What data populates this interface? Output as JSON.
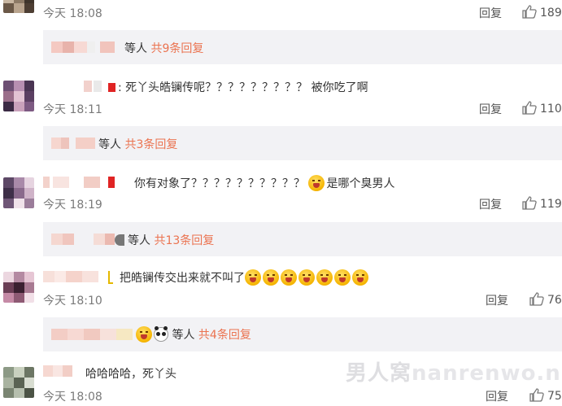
{
  "comments": [
    {
      "time_day": "今天",
      "time_clock": "18:08",
      "reply": "回复",
      "likes": "189"
    },
    {
      "text": "死丫头皓镧传呢？？？？？？？？？ 被你吃了啊",
      "time_day": "今天",
      "time_clock": "18:11",
      "reply": "回复",
      "likes": "110"
    },
    {
      "text": "你有对象了？？？？？？？？？？",
      "text_after": "是哪个臭男人",
      "time_day": "今天",
      "time_clock": "18:19",
      "reply": "回复",
      "likes": "119"
    },
    {
      "text": "把皓镧传交出来就不叫了",
      "time_day": "今天",
      "time_clock": "18:10",
      "reply": "回复",
      "likes": "76"
    },
    {
      "text": "哈哈哈哈，死丫头",
      "time_day": "今天",
      "time_clock": "18:08",
      "reply": "回复",
      "likes": "75"
    }
  ],
  "threads": [
    {
      "prefix": "等人",
      "count": "共9条回复"
    },
    {
      "prefix": "等人",
      "count": "共3条回复"
    },
    {
      "prefix": "等人",
      "count": "共13条回复"
    },
    {
      "prefix": "等人",
      "count": "共4条回复"
    }
  ],
  "watermark": {
    "cn": "男人窝",
    "latin": "nanrenwo.net"
  },
  "colors": {
    "accent": "#eb7350",
    "thread_bg": "#f2f2f5",
    "muted": "#7a7a7a"
  },
  "icons": [
    "thumbs-up-icon",
    "grin-emoji-icon",
    "panda-icon"
  ]
}
